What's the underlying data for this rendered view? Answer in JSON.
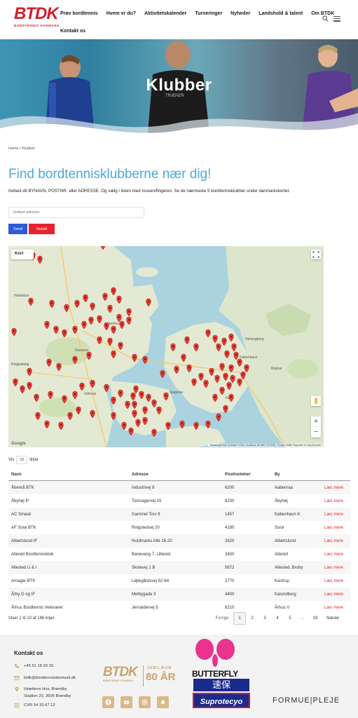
{
  "header": {
    "logo": "BTDK",
    "logo_sub": "BORDTENNIS DANMARK",
    "nav": [
      "Prøv bordtennis",
      "Hvem er du?",
      "Aktivitetskalender",
      "Turneringer",
      "Nyheder",
      "Landshold & talent",
      "Om BTDK"
    ],
    "nav_row2": "Kontakt os"
  },
  "hero": {
    "title": "Klubber",
    "shirt_text": "TRÆNER"
  },
  "breadcrumb": {
    "home": "Home",
    "sep": "/",
    "current": "Klubber"
  },
  "intro": {
    "title": "Find bordtennisklubberne nær dig!",
    "text": "Indtast dit BYNAVN, POSTNR. eller ADRESSE. Og vælg i listen med musen/fingeren. Se de nærmeste 5 bordtennisklubber under danmarkskortet.",
    "address_placeholder": "Indtast adresse",
    "send_label": "Send",
    "reset_label": "Nulstil"
  },
  "map": {
    "type_label": "Kort",
    "city_labels": [
      "Holstebro",
      "Ringkøbing",
      "Horsens",
      "Aarhus",
      "Helsingborg",
      "Malmø",
      "Køge",
      "Odense",
      "Slagelse",
      "København"
    ],
    "attribution": "Tastaturgenveje   Kortdata ©2024 GeoBasis-DE/BKG (©2009), Google   Vilkår   Rapporter en fejl på kortet",
    "google": "Google"
  },
  "table": {
    "show_prefix": "Vis",
    "show_value": "10",
    "show_suffix": "linjer",
    "headers": [
      "Navn",
      "Adresse",
      "Postnummer",
      "By"
    ],
    "more_label": "Læs mere",
    "rows": [
      [
        "Åbenrå BTK",
        "Industrivej 8",
        "6200",
        "Aabenraa"
      ],
      [
        "Åbyhøj IF",
        "Tomsagervej 15",
        "8230",
        "Åbyhøj"
      ],
      [
        "AC Smask",
        "Gammel Torv 8",
        "1457",
        "København K"
      ],
      [
        "AF Sorø BTK",
        "Ringstedvej 20",
        "4180",
        "Sorø"
      ],
      [
        "Albertslund IF",
        "Nordmarks Allé 16-20",
        "2620",
        "Albertslund"
      ],
      [
        "Allerød Bordtennisklub",
        "Banevang 7, Lillerød",
        "3450",
        "Allerød"
      ],
      [
        "Allested U & I",
        "Skolevej 1 B",
        "5672",
        "Allested, Broby"
      ],
      [
        "Amager BTK",
        "Løjtegårdsvej 62-64",
        "2770",
        "Kastrup"
      ],
      [
        "Årby G og IF",
        "Melbygade 3",
        "4400",
        "Kalundborg"
      ],
      [
        "Århus Bordtennis Veteraner",
        "Jernaldervej 5",
        "8210",
        "Århus V"
      ]
    ],
    "info": "Viser 1 til 10 af 186 linjer",
    "pager": {
      "prev": "Forrige",
      "pages": [
        "1",
        "2",
        "3",
        "4",
        "5"
      ],
      "ellipsis": "…",
      "last": "19",
      "next": "Næste"
    }
  },
  "footer": {
    "title": "Kontakt os",
    "phone": "+45 51 18 39 33",
    "email": "btdk@bordtennisdanmark.dk",
    "address_line1": "Idrættens Hus, Brøndby",
    "address_line2": "Stadion 20, 2605 Brøndby",
    "cvr": "CVR 54 33 67 13",
    "jubilee_mark": "BTDK",
    "jubilee_sub": "BORDTENNIS DANMARK",
    "jubilee_label": "JUBILÆUM",
    "jubilee_years": "80 ÅR",
    "sponsor1_word": "BUTTERFLY",
    "sponsor1_kanji": "速保",
    "sponsor1_brand": "Suprotecyo",
    "sponsor2": "FORMUE|PLEJE"
  },
  "colors": {
    "brand_red": "#d21e2a",
    "link_blue": "#4aa8dd",
    "send_blue": "#2d5bd4",
    "reset_red": "#e8232f",
    "gold": "#c9a56a"
  },
  "icons": [
    "search-icon",
    "menu-icon",
    "fullscreen-icon",
    "pegman-icon",
    "phone-icon",
    "mail-icon",
    "location-icon",
    "cvr-icon",
    "facebook-icon",
    "youtube-icon",
    "instagram-icon",
    "snapchat-icon"
  ]
}
